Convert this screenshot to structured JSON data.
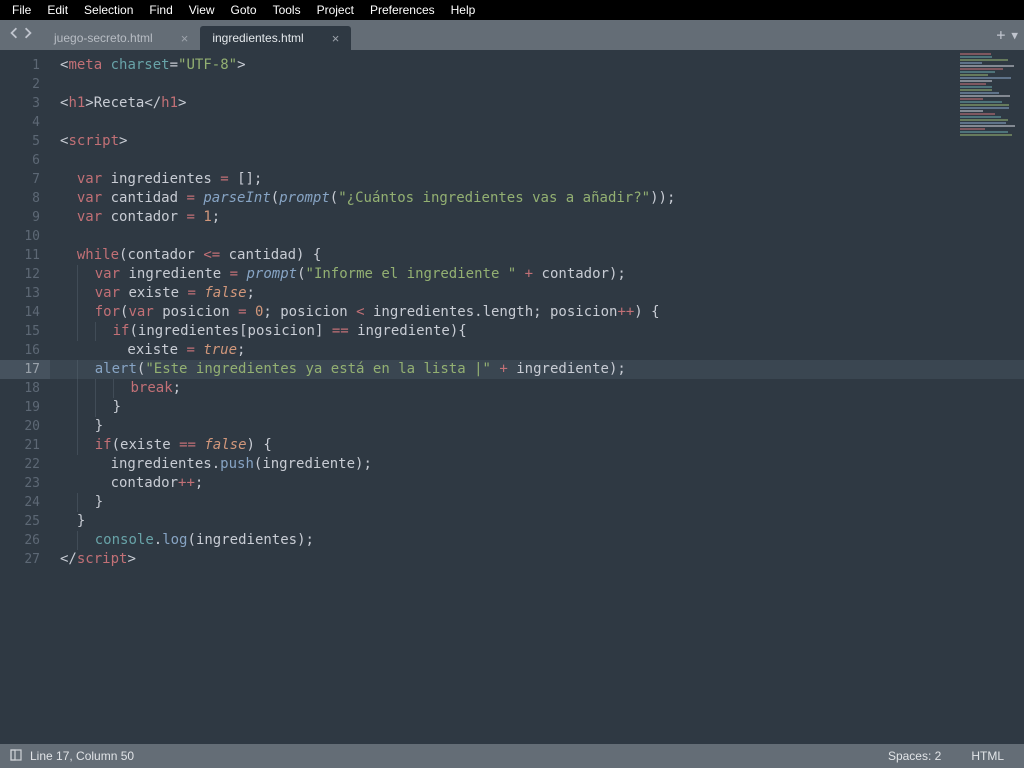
{
  "menu": [
    "File",
    "Edit",
    "Selection",
    "Find",
    "View",
    "Goto",
    "Tools",
    "Project",
    "Preferences",
    "Help"
  ],
  "tabs": [
    {
      "label": "juego-secreto.html",
      "active": false
    },
    {
      "label": "ingredientes.html",
      "active": true
    }
  ],
  "status": {
    "position": "Line 17, Column 50",
    "spaces": "Spaces: 2",
    "syntax": "HTML"
  },
  "gutter": {
    "from": 1,
    "to": 27,
    "highlight": 17
  },
  "colors": {
    "bg": "#2f3943",
    "tabbar": "#646d76",
    "red": "#c27076",
    "teal": "#68a3a8",
    "num": "#d1977b",
    "str": "#93b072",
    "blue": "#87a4c4"
  },
  "code": [
    {
      "t": [
        "<",
        "meta",
        " ",
        "charset",
        "=",
        "\"UTF-8\"",
        ">"
      ],
      "c": [
        "white",
        "red",
        "white",
        "teal",
        "white",
        "str",
        "white"
      ]
    },
    {
      "t": [
        ""
      ],
      "c": [
        "white"
      ]
    },
    {
      "t": [
        "<",
        "h1",
        ">",
        "Receta",
        "</",
        "h1",
        ">"
      ],
      "c": [
        "white",
        "red",
        "white",
        "white",
        "white",
        "red",
        "white"
      ]
    },
    {
      "t": [
        ""
      ],
      "c": [
        "white"
      ]
    },
    {
      "t": [
        "<",
        "script",
        ">"
      ],
      "c": [
        "white",
        "red",
        "white"
      ]
    },
    {
      "t": [
        ""
      ],
      "c": [
        "white"
      ]
    },
    {
      "t": [
        "  ",
        "var",
        " ingredientes ",
        "=",
        " ",
        "[]",
        ";"
      ],
      "c": [
        "white",
        "var",
        "white",
        "op",
        "white",
        "white",
        "white"
      ]
    },
    {
      "t": [
        "  ",
        "var",
        " cantidad ",
        "=",
        " ",
        "parseInt",
        "(",
        "prompt",
        "(",
        "\"¿Cuántos ingredientes vas a añadir?\"",
        "))",
        ";"
      ],
      "c": [
        "white",
        "var",
        "white",
        "op",
        "white",
        "fn-i",
        "white",
        "fn-i",
        "white",
        "str",
        "white",
        "white"
      ]
    },
    {
      "t": [
        "  ",
        "var",
        " contador ",
        "=",
        " ",
        "1",
        ";"
      ],
      "c": [
        "white",
        "var",
        "white",
        "op",
        "white",
        "num",
        "white"
      ]
    },
    {
      "t": [
        ""
      ],
      "c": [
        "white"
      ]
    },
    {
      "t": [
        "  ",
        "while",
        "(",
        "contador ",
        "<=",
        " cantidad",
        ")",
        " ",
        "{"
      ],
      "c": [
        "white",
        "kw",
        "white",
        "white",
        "op",
        "white",
        "white",
        "white",
        "white"
      ]
    },
    {
      "t": [
        "    ",
        "var",
        " ingrediente ",
        "=",
        " ",
        "prompt",
        "(",
        "\"Informe el ingrediente \"",
        " ",
        "+",
        " contador",
        ")",
        ";"
      ],
      "c": [
        "white",
        "var",
        "white",
        "op",
        "white",
        "fn-i",
        "white",
        "str",
        "white",
        "op",
        "white",
        "white",
        "white"
      ]
    },
    {
      "t": [
        "    ",
        "var",
        " existe ",
        "=",
        " ",
        "false",
        ";"
      ],
      "c": [
        "white",
        "var",
        "white",
        "op",
        "white",
        "bool",
        "white"
      ]
    },
    {
      "t": [
        "    ",
        "for",
        "(",
        "var",
        " posicion ",
        "=",
        " ",
        "0",
        "; posicion ",
        "<",
        " ingredientes",
        ".",
        "length",
        "; posicion",
        "++",
        ")",
        " ",
        "{"
      ],
      "c": [
        "white",
        "kw",
        "white",
        "var",
        "white",
        "op",
        "white",
        "num",
        "white",
        "op",
        "white",
        "white",
        "white",
        "white",
        "op",
        "white",
        "white",
        "white"
      ]
    },
    {
      "t": [
        "      ",
        "if",
        "(",
        "ingredientes",
        "[",
        "posicion",
        "]",
        " ",
        "==",
        " ingrediente",
        ")",
        "{"
      ],
      "c": [
        "white",
        "kw",
        "white",
        "white",
        "white",
        "white",
        "white",
        "white",
        "op",
        "white",
        "white",
        "white"
      ]
    },
    {
      "t": [
        "        existe ",
        "=",
        " ",
        "true",
        ";"
      ],
      "c": [
        "white",
        "op",
        "white",
        "bool",
        "white"
      ]
    },
    {
      "t": [
        "    ",
        "alert",
        "(",
        "\"Este ingredientes ya está en la lista ",
        "|",
        "\"",
        " ",
        "+",
        " ingrediente",
        ")",
        ";"
      ],
      "c": [
        "white",
        "fn",
        "white",
        "str",
        "str",
        "str",
        "white",
        "op",
        "white",
        "white",
        "white"
      ],
      "hl": true
    },
    {
      "t": [
        "        ",
        "break",
        ";"
      ],
      "c": [
        "white",
        "kw",
        "white"
      ]
    },
    {
      "t": [
        "      ",
        "}"
      ],
      "c": [
        "white",
        "white"
      ]
    },
    {
      "t": [
        "    ",
        "}"
      ],
      "c": [
        "white",
        "white"
      ]
    },
    {
      "t": [
        "    ",
        "if",
        "(",
        "existe ",
        "==",
        " ",
        "false",
        ")",
        " ",
        "{"
      ],
      "c": [
        "white",
        "kw",
        "white",
        "white",
        "op",
        "white",
        "bool",
        "white",
        "white",
        "white"
      ]
    },
    {
      "t": [
        "      ingredientes",
        ".",
        "push",
        "(",
        "ingrediente",
        ")",
        ";"
      ],
      "c": [
        "white",
        "white",
        "fn",
        "white",
        "white",
        "white",
        "white"
      ]
    },
    {
      "t": [
        "      contador",
        "++",
        ";"
      ],
      "c": [
        "white",
        "op",
        "white"
      ]
    },
    {
      "t": [
        "    ",
        "}"
      ],
      "c": [
        "white",
        "white"
      ]
    },
    {
      "t": [
        "  ",
        "}"
      ],
      "c": [
        "white",
        "white"
      ]
    },
    {
      "t": [
        "    ",
        "console",
        ".",
        "log",
        "(",
        "ingredientes",
        ")",
        ";"
      ],
      "c": [
        "white",
        "teal",
        "white",
        "fn",
        "white",
        "white",
        "white",
        "white"
      ]
    },
    {
      "t": [
        "</",
        "script",
        ">"
      ],
      "c": [
        "white",
        "red",
        "white"
      ]
    }
  ]
}
